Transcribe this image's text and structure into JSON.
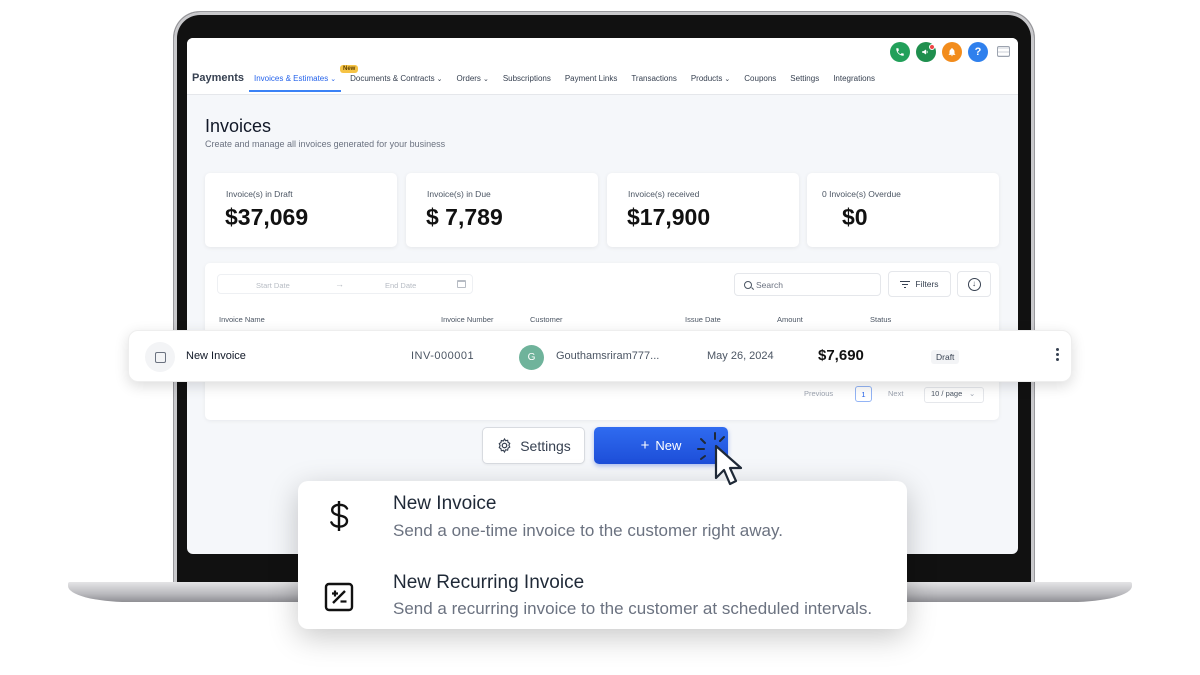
{
  "topbar": {
    "icons": [
      "phone-icon",
      "megaphone-icon",
      "bell-icon",
      "help-icon",
      "flag-icon"
    ],
    "colors": {
      "phone": "#22a05a",
      "megaphone": "#1f8f4e",
      "bell": "#f28c1c",
      "help": "#2f80ed"
    }
  },
  "nav": {
    "brand": "Payments",
    "items": [
      {
        "label": "Invoices & Estimates",
        "dropdown": true,
        "active": true
      },
      {
        "label": "Documents & Contracts",
        "dropdown": true
      },
      {
        "label": "Orders",
        "dropdown": true
      },
      {
        "label": "Subscriptions"
      },
      {
        "label": "Payment Links"
      },
      {
        "label": "Transactions"
      },
      {
        "label": "Products",
        "dropdown": true
      },
      {
        "label": "Coupons"
      },
      {
        "label": "Settings"
      },
      {
        "label": "Integrations"
      }
    ],
    "new_badge": "New"
  },
  "page": {
    "title": "Invoices",
    "subtitle": "Create and manage all invoices generated for your business"
  },
  "stats": [
    {
      "label": "Invoice(s) in Draft",
      "value": "$37,069"
    },
    {
      "label": "Invoice(s) in Due",
      "value": "$ 7,789"
    },
    {
      "label": "Invoice(s) received",
      "value": "$17,900"
    },
    {
      "label": "0 Invoice(s) Overdue",
      "value": "$0"
    }
  ],
  "filters": {
    "start_date": "Start Date",
    "end_date": "End Date",
    "search_placeholder": "Search",
    "filters_label": "Filters"
  },
  "table": {
    "columns": [
      "Invoice Name",
      "Invoice Number",
      "Customer",
      "Issue Date",
      "Amount",
      "Status"
    ],
    "row": {
      "name": "New Invoice",
      "number": "INV-000001",
      "avatar": "G",
      "customer": "Gouthamsriram777...",
      "date": "May 26, 2024",
      "amount": "$7,690",
      "status": "Draft"
    },
    "pagination": {
      "previous": "Previous",
      "page": "1",
      "next": "Next",
      "per_page": "10 / page"
    }
  },
  "actions": {
    "settings": "Settings",
    "new": "New",
    "accent": "#1d4ed8"
  },
  "menu": {
    "items": [
      {
        "title": "New Invoice",
        "desc": "Send a one-time invoice to the customer right away.",
        "icon": "dollar-icon"
      },
      {
        "title": "New Recurring Invoice",
        "desc": "Send a recurring invoice to the customer at scheduled intervals.",
        "icon": "percent-square-icon"
      }
    ]
  }
}
